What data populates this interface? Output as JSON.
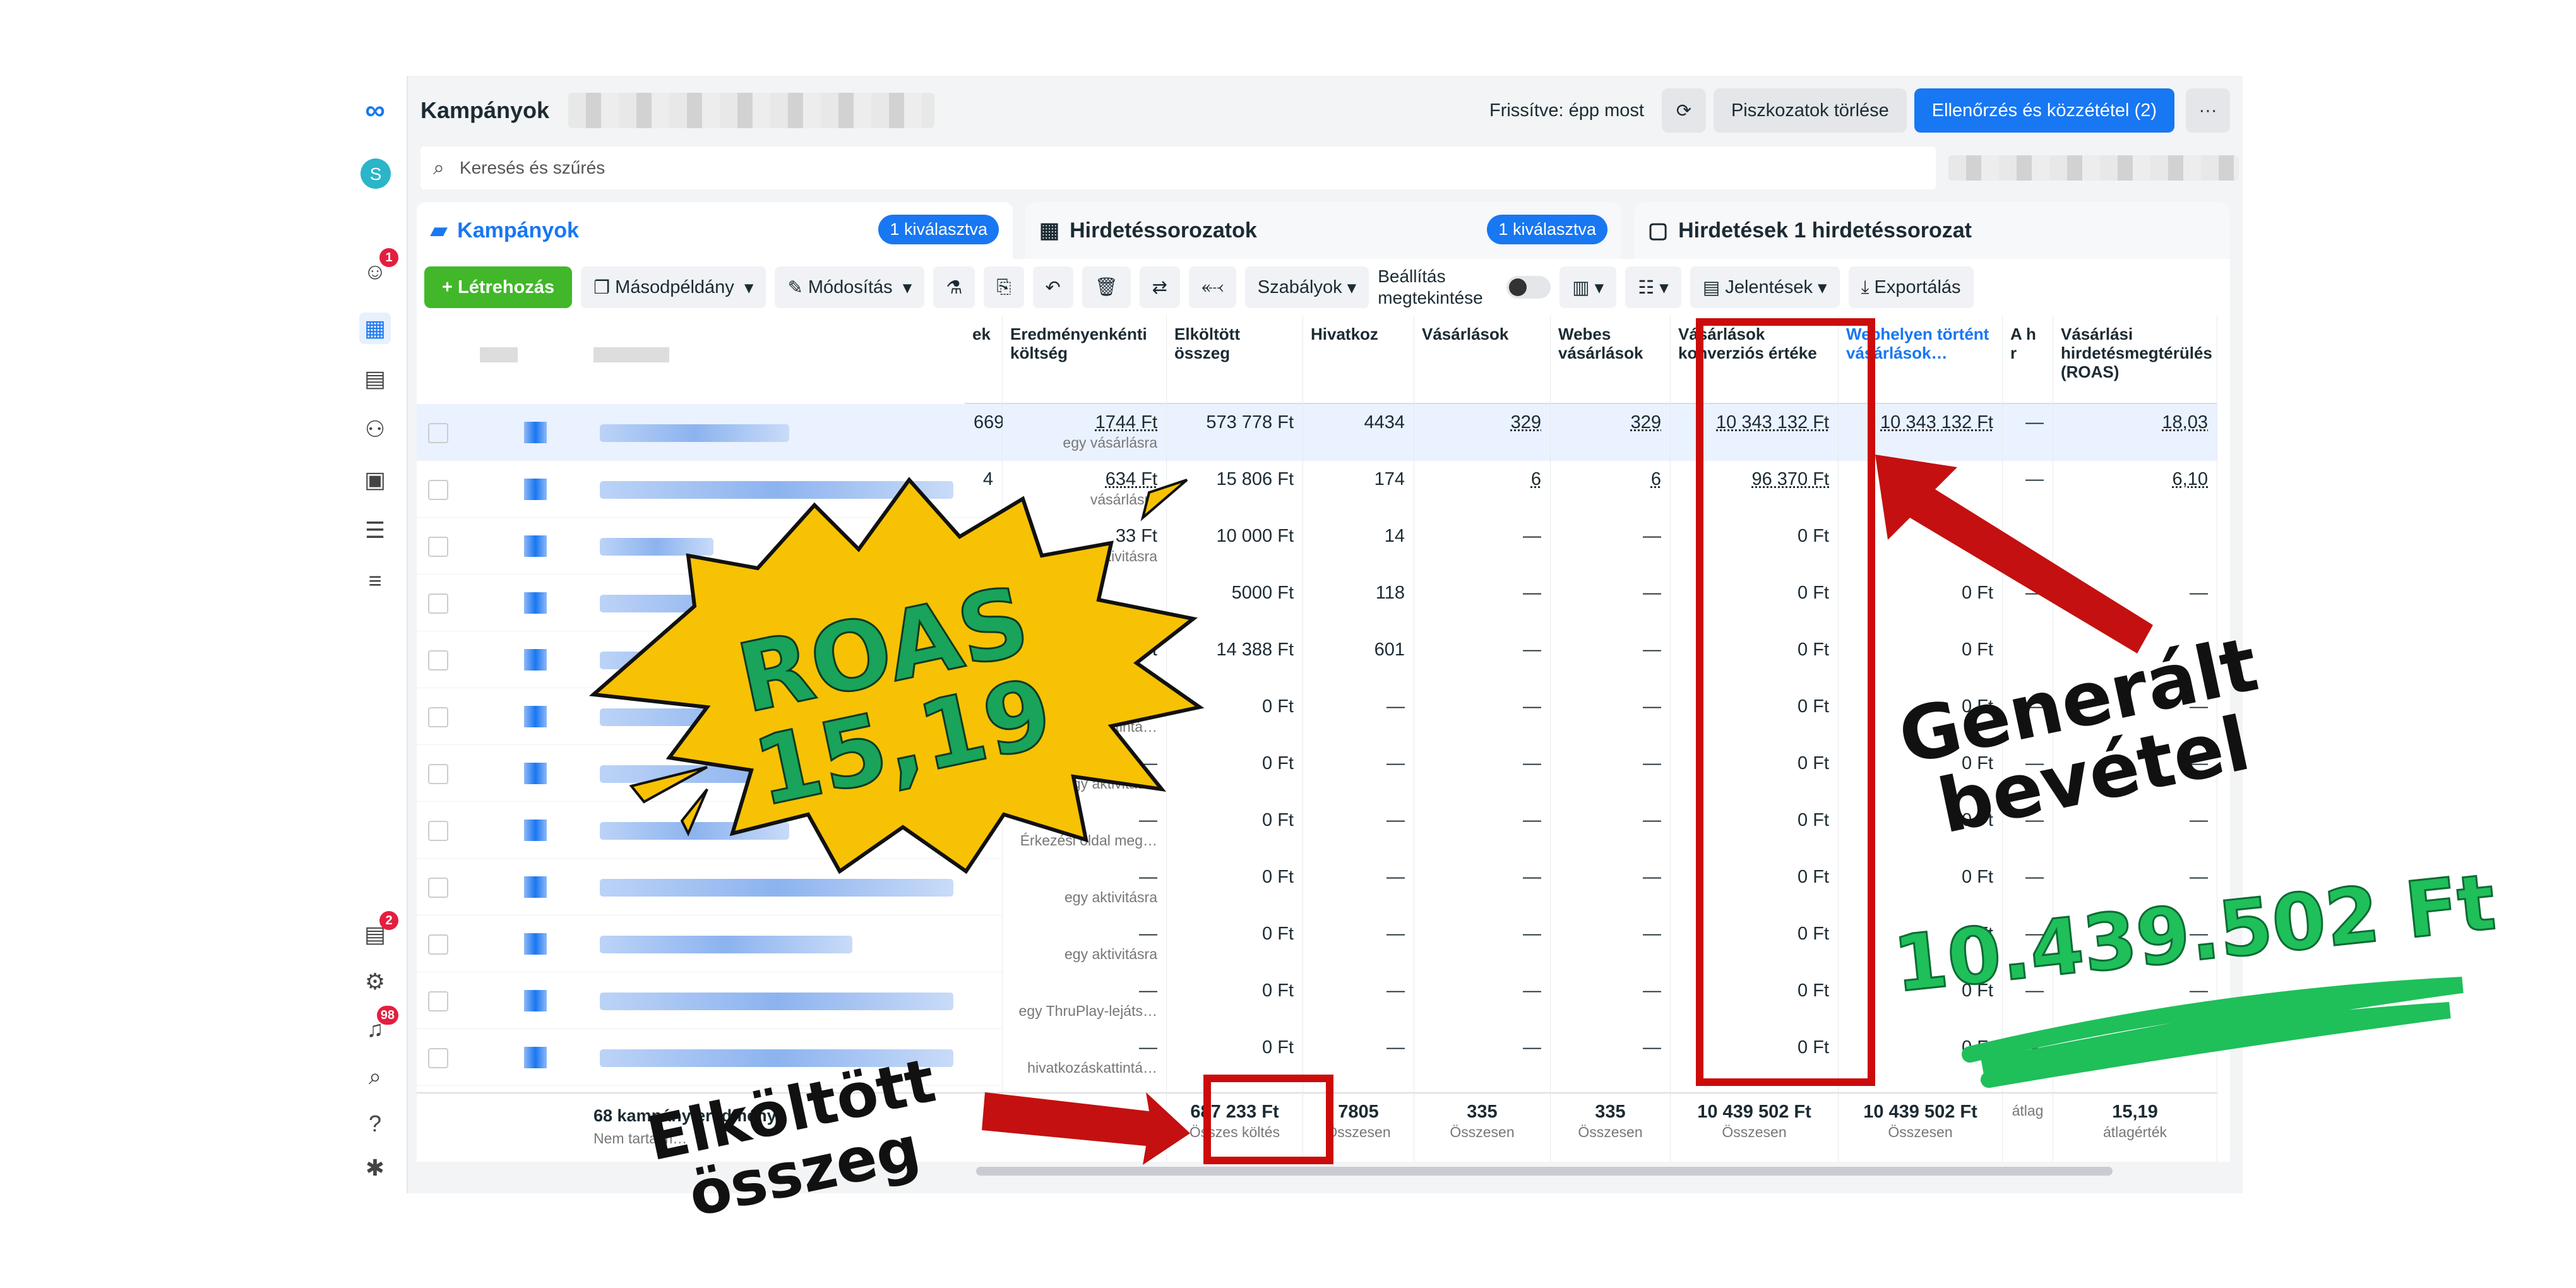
{
  "header": {
    "title": "Kampányok",
    "refreshed": "Frissítve: épp most",
    "clear_drafts": "Piszkozatok törlése",
    "publish": "Ellenőrzés és közzététel (2)",
    "more": "···"
  },
  "search": {
    "placeholder": "Keresés és szűrés"
  },
  "tabs": [
    {
      "label": "Kampányok",
      "badge": "1 kiválasztva"
    },
    {
      "label": "Hirdetéssorozatok",
      "badge": "1 kiválasztva"
    },
    {
      "label": "Hirdetések 1 hirdetéssorozat",
      "badge": ""
    }
  ],
  "toolbar": {
    "create": "Létrehozás",
    "duplicate": "Másodpéldány",
    "edit": "Módosítás",
    "rules": "Szabályok",
    "preview": "Beállítás megtekintése",
    "reports": "Jelentések",
    "export": "Exportálás"
  },
  "sidebar": {
    "badge_notifications": "1",
    "badge_pages": "2",
    "badge_alerts": "98"
  },
  "columns": [
    {
      "label": "ek"
    },
    {
      "label": "Eredményenkénti költség"
    },
    {
      "label": "Elköltött összeg"
    },
    {
      "label": "Hivatkoz"
    },
    {
      "label": "Vásárlások"
    },
    {
      "label": "Webes vásárlások"
    },
    {
      "label": "Vásárlások konverziós értéke"
    },
    {
      "label": "Webhelyen történt vásárlások…"
    },
    {
      "label": "A h r"
    },
    {
      "label": "Vásárlási hirdetésmegtérülés (ROAS)"
    }
  ],
  "rows": [
    [
      "669",
      "1744 Ft",
      "573 778 Ft",
      "4434",
      "329",
      "329",
      "10 343 132 Ft",
      "10 343 132 Ft",
      "—",
      "18,03"
    ],
    [
      "4",
      "634 Ft",
      "15 806 Ft",
      "174",
      "6",
      "6",
      "96 370 Ft",
      "",
      "—",
      "6,10"
    ],
    [
      "",
      "33 Ft",
      "10 000 Ft",
      "14",
      "—",
      "—",
      "0 Ft",
      "—",
      "",
      ""
    ],
    [
      "",
      "",
      "5000 Ft",
      "118",
      "—",
      "—",
      "0 Ft",
      "0 Ft",
      "—",
      "—"
    ],
    [
      "",
      "24 Ft",
      "14 388 Ft",
      "601",
      "—",
      "—",
      "0 Ft",
      "0 Ft",
      "",
      ""
    ],
    [
      "",
      "—",
      "0 Ft",
      "—",
      "—",
      "—",
      "0 Ft",
      "0 Ft",
      "—",
      "—"
    ],
    [
      "",
      "—",
      "0 Ft",
      "—",
      "—",
      "—",
      "0 Ft",
      "0 Ft",
      "—",
      "—"
    ],
    [
      "",
      "—",
      "0 Ft",
      "—",
      "—",
      "—",
      "0 Ft",
      "0 Ft",
      "—",
      "—"
    ],
    [
      "",
      "—",
      "0 Ft",
      "—",
      "—",
      "—",
      "0 Ft",
      "0 Ft",
      "—",
      "—"
    ],
    [
      "",
      "—",
      "0 Ft",
      "—",
      "—",
      "—",
      "0 Ft",
      "0 Ft",
      "—",
      "—"
    ],
    [
      "",
      "—",
      "0 Ft",
      "—",
      "—",
      "—",
      "0 Ft",
      "0 Ft",
      "—",
      "—"
    ],
    [
      "",
      "—",
      "0 Ft",
      "—",
      "—",
      "—",
      "0 Ft",
      "0 Ft",
      "—",
      "—"
    ]
  ],
  "row_subs": [
    "egy vásárlásra",
    "vásárlásra",
    "egy aktivitásra",
    "",
    "kattintá…",
    "rkozáskattintá…",
    "egy aktivitásra",
    "Érkezési oldal meg…",
    "egy aktivitásra",
    "egy aktivitásra",
    "egy ThruPlay-lejáts…",
    "hivatkozáskattintá…"
  ],
  "totals": {
    "label": "68 kampány eredménye",
    "sub": "Nem tartalm…",
    "cells": [
      "",
      "—",
      "687 233 Ft",
      "7805",
      "335",
      "335",
      "10 439 502 Ft",
      "10 439 502 Ft",
      "",
      "15,19"
    ],
    "subs": [
      "",
      "zesen",
      "Összes költés",
      "Összesen",
      "Összesen",
      "Összesen",
      "Összesen",
      "Összesen",
      "átlag",
      "átlagérték"
    ]
  },
  "annotations": {
    "roas": "ROAS\n15,19",
    "revenue": "Generált\nbevétel",
    "revenue_value": "10.439.502 Ft",
    "spent": "Elköltött\nösszeg"
  }
}
